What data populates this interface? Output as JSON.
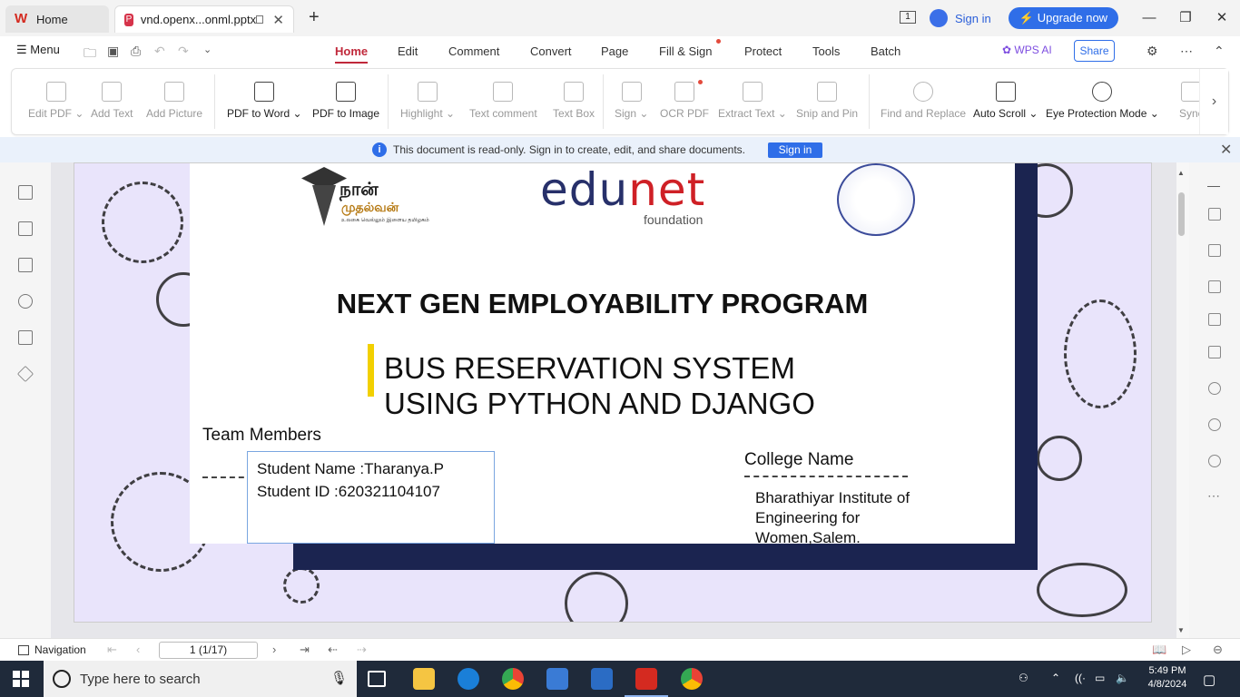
{
  "titlebar": {
    "home_tab": "Home",
    "doc_tab": "vnd.openx...onml.pptx",
    "sign_in": "Sign in",
    "upgrade": "Upgrade now",
    "badge": "1"
  },
  "menubar": {
    "menu": "Menu",
    "tabs": [
      "Home",
      "Edit",
      "Comment",
      "Convert",
      "Page",
      "Fill & Sign",
      "Protect",
      "Tools",
      "Batch"
    ],
    "wps_ai": "WPS AI",
    "share": "Share"
  },
  "ribbon": {
    "items": [
      "Edit PDF",
      "Add Text",
      "Add Picture",
      "PDF to Word",
      "PDF to Image",
      "Highlight",
      "Text comment",
      "Text Box",
      "Sign",
      "OCR PDF",
      "Extract Text",
      "Snip and Pin",
      "Find and Replace",
      "Auto Scroll",
      "Eye Protection Mode",
      "Sync"
    ]
  },
  "infobar": {
    "message": "This document is read-only. Sign in to create, edit, and share documents.",
    "sign_in": "Sign in"
  },
  "slide": {
    "logo1_line1": "நான்",
    "logo1_line2": "முதல்வன்",
    "logo1_line3": "உலகை வெல்லும் இளைய தமிழகம்",
    "logo2_a": "edu",
    "logo2_b": "net",
    "logo2_sub": "foundation",
    "headline": "NEXT GEN EMPLOYABILITY PROGRAM",
    "subtitle1": "BUS RESERVATION SYSTEM",
    "subtitle2": "USING PYTHON AND DJANGO",
    "team_label": "Team Members",
    "student_name": "Student Name :Tharanya.P",
    "student_id": "Student ID :620321104107",
    "college_label": "College Name",
    "college_name": "Bharathiyar Institute of Engineering for Women,Salem."
  },
  "statusbar": {
    "navigation": "Navigation",
    "page": "1 (1/17)"
  },
  "taskbar": {
    "search_placeholder": "Type here to search",
    "time": "5:49 PM",
    "date": "4/8/2024"
  },
  "colors": {
    "accent": "#c0283a",
    "brand_blue": "#2f6ee8",
    "slide_bg": "#e9e4fb",
    "navy": "#1b2450"
  }
}
